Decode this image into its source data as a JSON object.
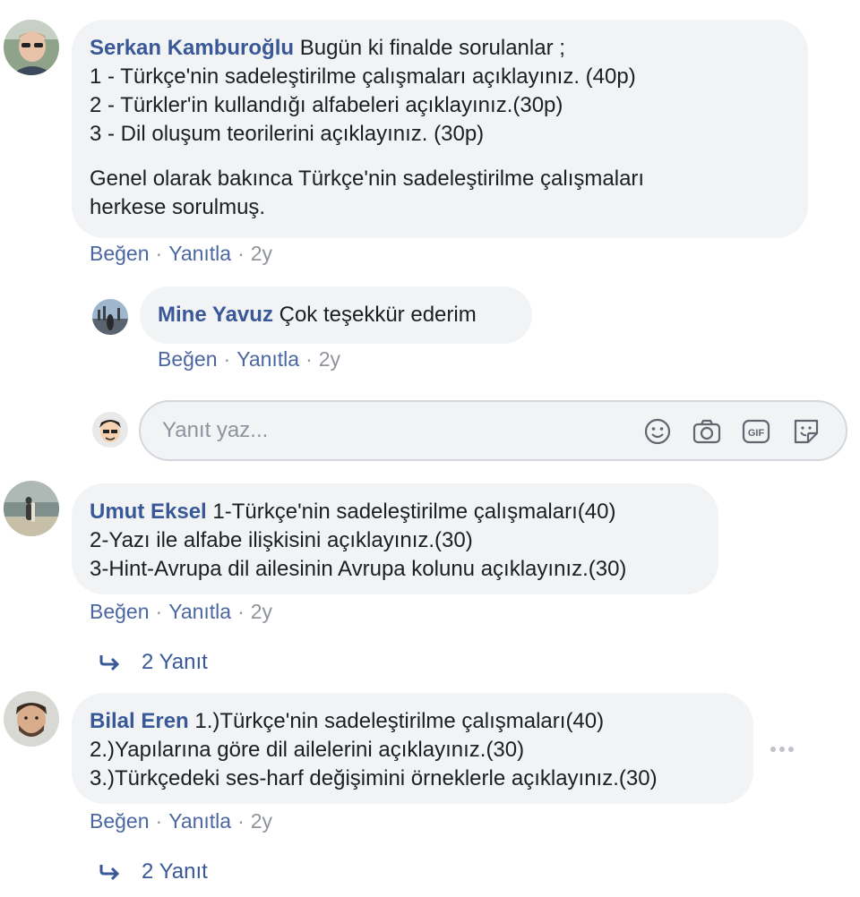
{
  "comments": [
    {
      "author": "Serkan Kamburoğlu",
      "lines": [
        "Bugün ki finalde sorulanlar ;",
        "1 - Türkçe'nin sadeleştirilme çalışmaları açıklayınız. (40p)",
        "2 - Türkler'in kullandığı alfabeleri açıklayınız.(30p)",
        "3 - Dil oluşum teorilerini açıklayınız. (30p)"
      ],
      "paragraph2": [
        "Genel olarak bakınca Türkçe'nin sadeleştirilme çalışmaları",
        "herkese sorulmuş."
      ],
      "like": "Beğen",
      "reply": "Yanıtla",
      "time": "2y"
    },
    {
      "author": "Mine Yavuz",
      "lines": [
        "Çok teşekkür ederim"
      ],
      "like": "Beğen",
      "reply": "Yanıtla",
      "time": "2y"
    },
    {
      "author": "Umut Eksel",
      "lines": [
        "1-Türkçe'nin sadeleştirilme çalışmaları(40)",
        "2-Yazı ile alfabe ilişkisini açıklayınız.(30)",
        "3-Hint-Avrupa dil ailesinin Avrupa kolunu açıklayınız.(30)"
      ],
      "like": "Beğen",
      "reply": "Yanıtla",
      "time": "2y",
      "replies": "2 Yanıt"
    },
    {
      "author": "Bilal Eren",
      "lines": [
        "1.)Türkçe'nin sadeleştirilme çalışmaları(40)",
        "2.)Yapılarına göre dil ailelerini açıklayınız.(30)",
        "3.)Türkçedeki ses-harf değişimini örneklerle açıklayınız.(30)"
      ],
      "like": "Beğen",
      "reply": "Yanıtla",
      "time": "2y",
      "replies": "2 Yanıt"
    }
  ],
  "reply_input": {
    "placeholder": "Yanıt yaz...",
    "icons": [
      "emoji-icon",
      "camera-icon",
      "gif-icon",
      "sticker-icon"
    ]
  },
  "separator": "·",
  "colors": {
    "link": "#385898",
    "bubble": "#f2f3f5",
    "meta": "#90949c"
  }
}
